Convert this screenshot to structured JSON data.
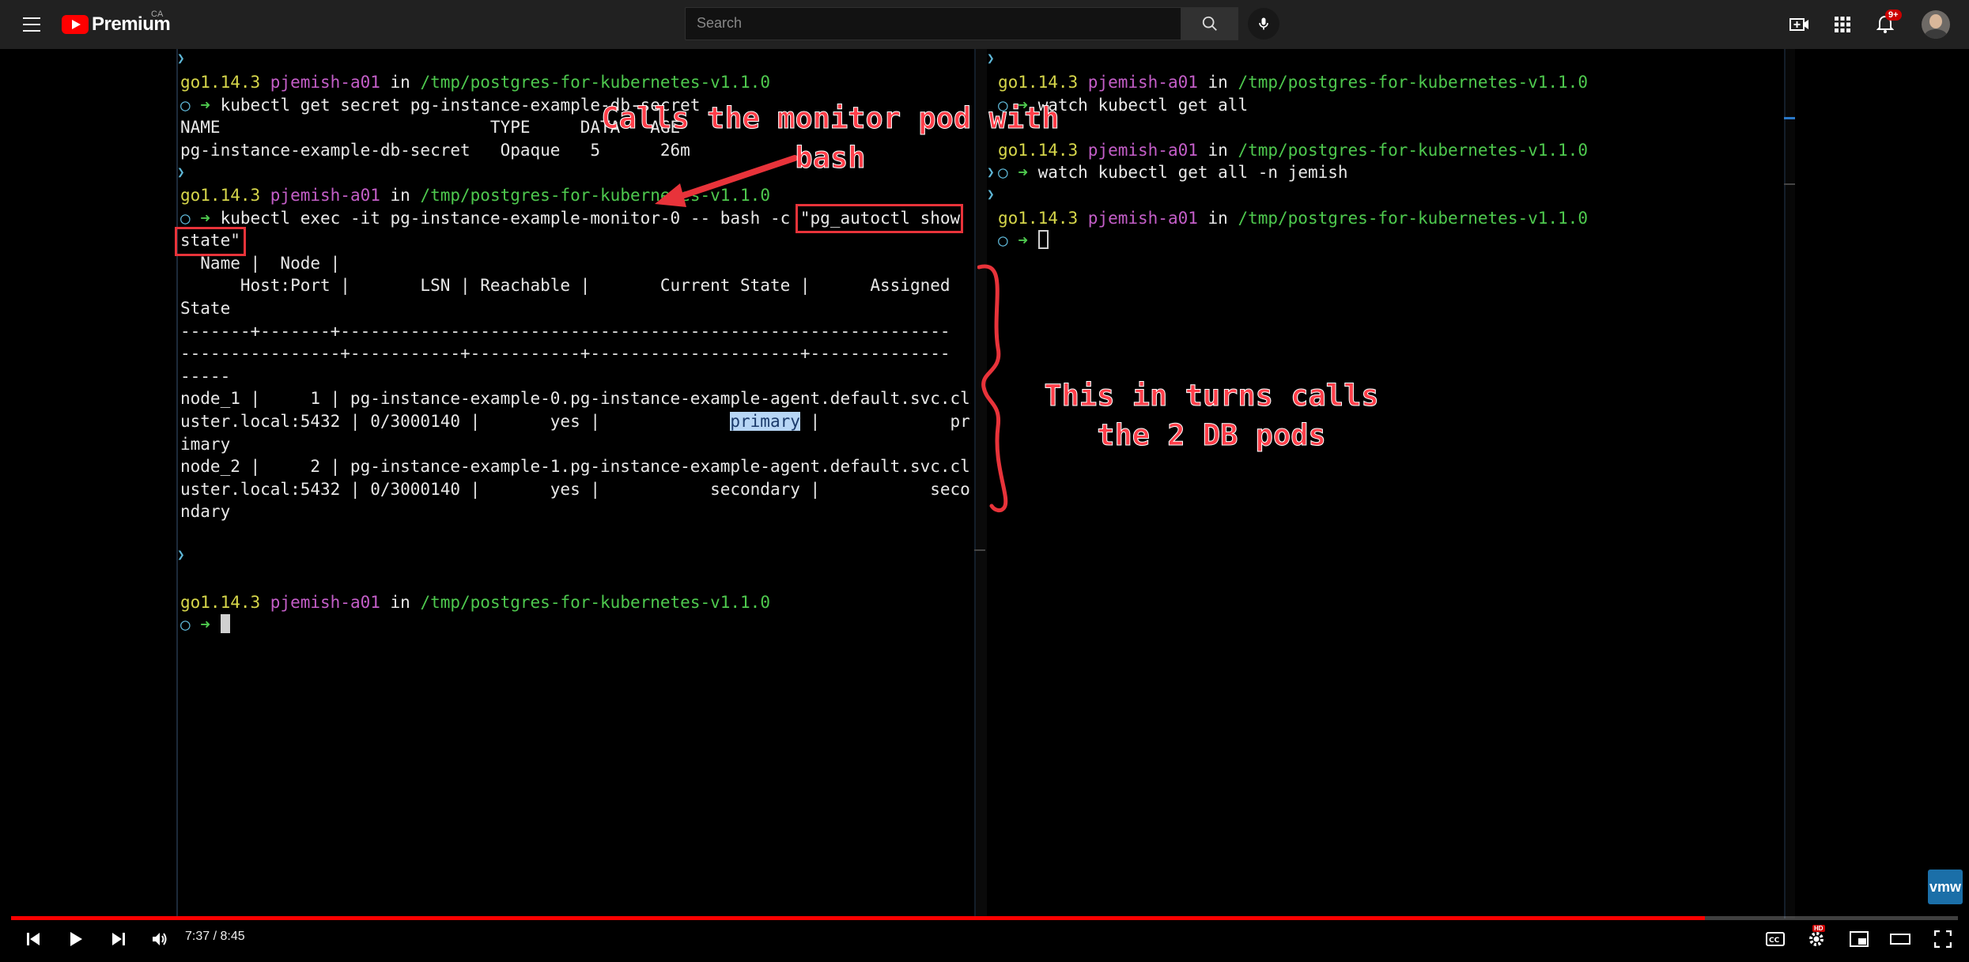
{
  "masthead": {
    "logo_text": "Premium",
    "country": "CA",
    "search_placeholder": "Search",
    "notification_count": "9+"
  },
  "left_terminal": {
    "lines": [
      [
        {
          "t": "go1.14.3",
          "c": "yellow"
        },
        {
          "t": " pjemish-a01",
          "c": "magenta"
        },
        {
          "t": " in ",
          "c": "white"
        },
        {
          "t": "/tmp/postgres-for-kubernetes-v1.1.0",
          "c": "green"
        }
      ],
      [
        {
          "t": "○ ",
          "c": "cyan"
        },
        {
          "t": "➜ ",
          "c": "green"
        },
        {
          "t": "kubectl get secret pg-instance-example-db-secret",
          "c": "white"
        }
      ],
      [
        {
          "t": "NAME                           TYPE     DATA   AGE",
          "c": "white"
        }
      ],
      [
        {
          "t": "pg-instance-example-db-secret   Opaque   5      26m",
          "c": "white"
        }
      ],
      [
        {
          "t": "",
          "c": "white"
        }
      ],
      [
        {
          "t": "go1.14.3",
          "c": "yellow"
        },
        {
          "t": " pjemish-a01",
          "c": "magenta"
        },
        {
          "t": " in ",
          "c": "white"
        },
        {
          "t": "/tmp/postgres-for-kubernetes-v1.1.0",
          "c": "green"
        }
      ],
      [
        {
          "t": "○ ",
          "c": "cyan"
        },
        {
          "t": "➜ ",
          "c": "green"
        },
        {
          "t": "kubectl exec -it pg-instance-example-monitor-0 -- bash -c \"pg_autoctl show",
          "c": "white"
        }
      ],
      [
        {
          "t": "state\"",
          "c": "white"
        }
      ],
      [
        {
          "t": "  Name |  Node |",
          "c": "white"
        }
      ],
      [
        {
          "t": "      Host:Port |       LSN | Reachable |       Current State |      Assigned",
          "c": "white"
        }
      ],
      [
        {
          "t": "State",
          "c": "white"
        }
      ],
      [
        {
          "t": "-------+-------+-------------------------------------------------------------",
          "c": "white"
        }
      ],
      [
        {
          "t": "----------------+-----------+-----------+---------------------+--------------",
          "c": "white"
        }
      ],
      [
        {
          "t": "-----",
          "c": "white"
        }
      ],
      [
        {
          "t": "node_1 |     1 | pg-instance-example-0.pg-instance-example-agent.default.svc.cl",
          "c": "white"
        }
      ],
      [
        {
          "t": "uster.local:5432 | 0/3000140 |       yes |             ",
          "c": "white"
        },
        {
          "t": "primary",
          "c": "hl"
        },
        {
          "t": " |             pr",
          "c": "white"
        }
      ],
      [
        {
          "t": "imary",
          "c": "white"
        }
      ],
      [
        {
          "t": "node_2 |     2 | pg-instance-example-1.pg-instance-example-agent.default.svc.cl",
          "c": "white"
        }
      ],
      [
        {
          "t": "uster.local:5432 | 0/3000140 |       yes |           secondary |           seco",
          "c": "white"
        }
      ],
      [
        {
          "t": "ndary",
          "c": "white"
        }
      ],
      [
        {
          "t": "",
          "c": "white"
        }
      ],
      [
        {
          "t": "",
          "c": "white"
        }
      ],
      [
        {
          "t": "",
          "c": "white"
        }
      ],
      [
        {
          "t": "go1.14.3",
          "c": "yellow"
        },
        {
          "t": " pjemish-a01",
          "c": "magenta"
        },
        {
          "t": " in ",
          "c": "white"
        },
        {
          "t": "/tmp/postgres-for-kubernetes-v1.1.0",
          "c": "green"
        }
      ],
      [
        {
          "t": "○ ",
          "c": "cyan"
        },
        {
          "t": "➜ ",
          "c": "green"
        },
        {
          "t": "",
          "c": "cursor"
        }
      ]
    ]
  },
  "right_terminal": {
    "lines": [
      [
        {
          "t": "go1.14.3",
          "c": "yellow"
        },
        {
          "t": " pjemish-a01",
          "c": "magenta"
        },
        {
          "t": " in ",
          "c": "white"
        },
        {
          "t": "/tmp/postgres-for-kubernetes-v1.1.0",
          "c": "green"
        }
      ],
      [
        {
          "t": "○ ",
          "c": "cyan"
        },
        {
          "t": "➜ ",
          "c": "green"
        },
        {
          "t": "watch kubectl get all",
          "c": "white"
        }
      ],
      [
        {
          "t": "",
          "c": "white"
        }
      ],
      [
        {
          "t": "go1.14.3",
          "c": "yellow"
        },
        {
          "t": " pjemish-a01",
          "c": "magenta"
        },
        {
          "t": " in ",
          "c": "white"
        },
        {
          "t": "/tmp/postgres-for-kubernetes-v1.1.0",
          "c": "green"
        }
      ],
      [
        {
          "t": "○ ",
          "c": "cyan"
        },
        {
          "t": "➜ ",
          "c": "green"
        },
        {
          "t": "watch kubectl get all -n jemish",
          "c": "white"
        }
      ],
      [
        {
          "t": "",
          "c": "white"
        }
      ],
      [
        {
          "t": "go1.14.3",
          "c": "yellow"
        },
        {
          "t": " pjemish-a01",
          "c": "magenta"
        },
        {
          "t": " in ",
          "c": "white"
        },
        {
          "t": "/tmp/postgres-for-kubernetes-v1.1.0",
          "c": "green"
        }
      ],
      [
        {
          "t": "○ ",
          "c": "cyan"
        },
        {
          "t": "➜ ",
          "c": "green"
        },
        {
          "t": "",
          "c": "cursor-outline"
        }
      ]
    ]
  },
  "annotations": {
    "monitor_line1": "Calls the monitor pod with",
    "monitor_line2": "bash",
    "db_line1": "This in turns calls",
    "db_line2": "the 2 DB pods"
  },
  "watermark": "vmw",
  "player": {
    "current_time": "7:37",
    "duration": "8:45",
    "time_display": "7:37 / 8:45",
    "progress_fraction": 0.87,
    "hd_label": "HD"
  },
  "colors": {
    "accent": "#ff0000",
    "annotation": "#ff3f4a",
    "prompt_version": "#d6d64a",
    "prompt_user": "#c45ec8",
    "prompt_path": "#4ec94e"
  }
}
